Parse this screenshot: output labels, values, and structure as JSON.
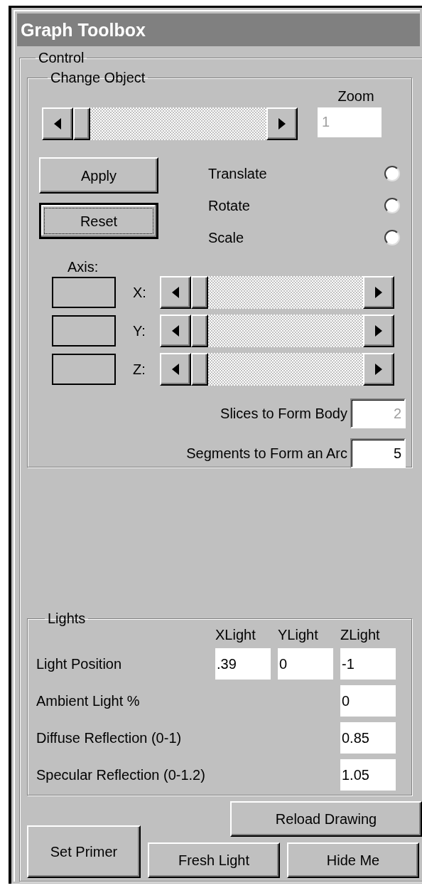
{
  "window": {
    "title": "Graph Toolbox"
  },
  "control": {
    "legend": "Control",
    "change_object": {
      "legend": "Change Object",
      "zoom": {
        "label": "Zoom",
        "value": "1",
        "disabled": true
      },
      "zoom_scrollbar": {
        "level": 0
      },
      "buttons": [
        {
          "label": "Apply",
          "focused": false
        },
        {
          "label": "Reset",
          "focused": true
        }
      ],
      "modes": [
        {
          "label": "Translate",
          "selected": false
        },
        {
          "label": "Rotate",
          "selected": false
        },
        {
          "label": "Scale",
          "selected": false
        }
      ],
      "axis": {
        "label": "Axis:",
        "rows": [
          {
            "label": "X:",
            "level": 0
          },
          {
            "label": "Y:",
            "level": 0
          },
          {
            "label": "Z:",
            "level": 0
          }
        ]
      },
      "settings": [
        {
          "label": "Slices to Form Body",
          "value": "2",
          "disabled": true
        },
        {
          "label": "Segments to Form an Arc",
          "value": "5",
          "disabled": false
        }
      ]
    },
    "lights": {
      "legend": "Lights",
      "columns": [
        "XLight",
        "YLight",
        "ZLight"
      ],
      "rows": [
        {
          "label": "Light Position",
          "values": [
            ".39",
            "0",
            "-1"
          ]
        },
        {
          "label": "Ambient Light %",
          "values": [
            "0"
          ]
        },
        {
          "label": "Diffuse Reflection (0-1)",
          "values": [
            "0.85"
          ]
        },
        {
          "label": "Specular Reflection (0-1.2)",
          "values": [
            "1.05"
          ]
        }
      ]
    },
    "buttons": [
      {
        "label": "Reload Drawing"
      },
      {
        "label": "Set Primer"
      },
      {
        "label": "Fresh Light"
      },
      {
        "label": "Hide Me"
      }
    ]
  }
}
